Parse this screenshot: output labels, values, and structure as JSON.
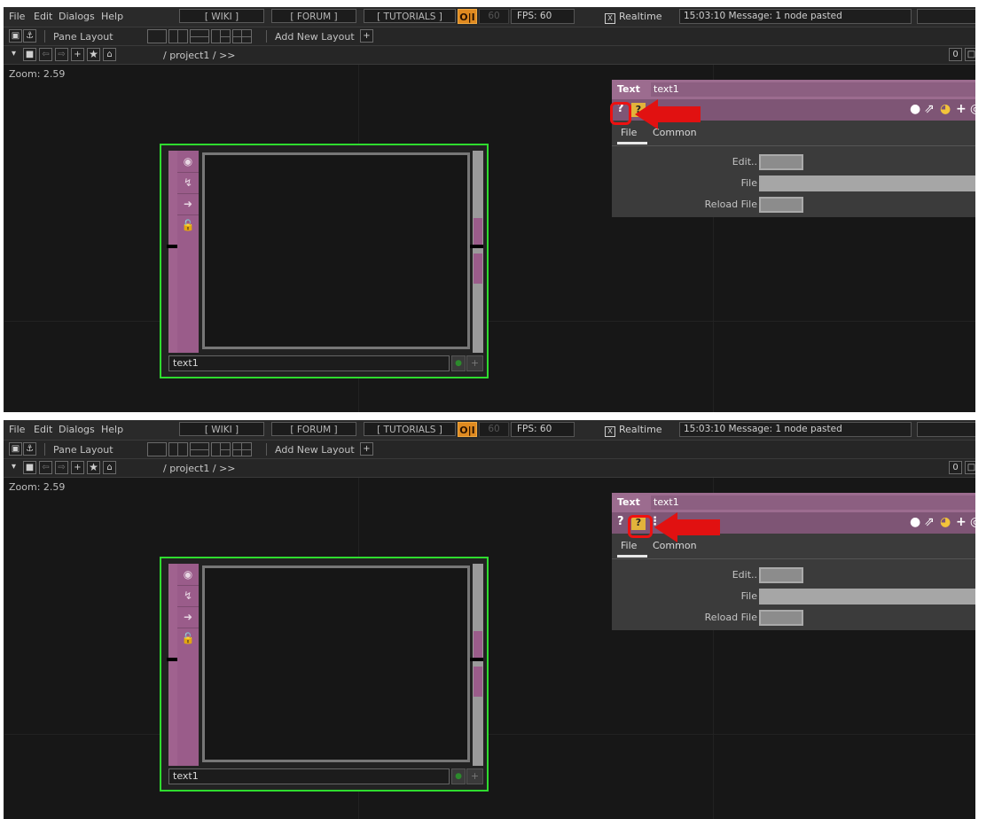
{
  "menu": {
    "file": "File",
    "edit": "Edit",
    "dialogs": "Dialogs",
    "help": "Help",
    "wiki": "[ WIKI ]",
    "forum": "[ FORUM ]",
    "tutorials": "[ TUTORIALS ]",
    "oi": "O|I",
    "fps_target": "60",
    "fps": "FPS: 60",
    "realtime": "Realtime",
    "realtime_check": "X",
    "message": "15:03:10 Message: 1 node pasted"
  },
  "layout_bar": {
    "pane_layout": "Pane Layout",
    "add_new_layout": "Add New Layout",
    "add_icon": "+"
  },
  "path_bar": {
    "path": "/ project1 / >>",
    "right_zero": "0"
  },
  "network": {
    "zoom": "Zoom: 2.59"
  },
  "node": {
    "name": "text1"
  },
  "panel": {
    "type": "Text",
    "name": "text1",
    "help_icon": "?",
    "help_python_icon": "?",
    "tabs": [
      "File",
      "Common"
    ],
    "params": {
      "edit": "Edit..",
      "file": "File",
      "reload": "Reload File"
    }
  },
  "accent_colors": {
    "highlight": "#2fdc2f",
    "annotation": "#e11111",
    "node_purple": "#9a5c8a",
    "oi_orange": "#e08a20"
  }
}
